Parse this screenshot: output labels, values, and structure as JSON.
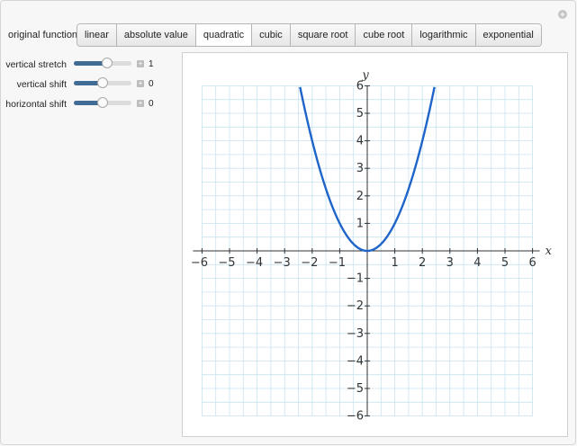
{
  "controls": {
    "function_label": "original function",
    "functions": [
      "linear",
      "absolute value",
      "quadratic",
      "cubic",
      "square root",
      "cube root",
      "logarithmic",
      "exponential"
    ],
    "selected_function": "quadratic",
    "sliders": [
      {
        "label": "vertical stretch",
        "value": "1",
        "fraction": 0.58
      },
      {
        "label": "vertical shift",
        "value": "0",
        "fraction": 0.5
      },
      {
        "label": "horizontal shift",
        "value": "0",
        "fraction": 0.5
      }
    ]
  },
  "chart_data": {
    "type": "line",
    "xlabel": "x",
    "ylabel": "y",
    "xlim": [
      -6,
      6
    ],
    "ylim": [
      -6,
      6
    ],
    "xticks": [
      -6,
      -5,
      -4,
      -3,
      -2,
      -1,
      1,
      2,
      3,
      4,
      5,
      6
    ],
    "yticks": [
      -6,
      -5,
      -4,
      -3,
      -2,
      -1,
      1,
      2,
      3,
      4,
      5,
      6
    ],
    "grid": true,
    "series": [
      {
        "function": "x^2",
        "color": "#1f64c8"
      }
    ]
  },
  "colors": {
    "curve": "#1f64c8",
    "grid": "#c9e3f0",
    "slider_fill": "#3f6b94"
  }
}
